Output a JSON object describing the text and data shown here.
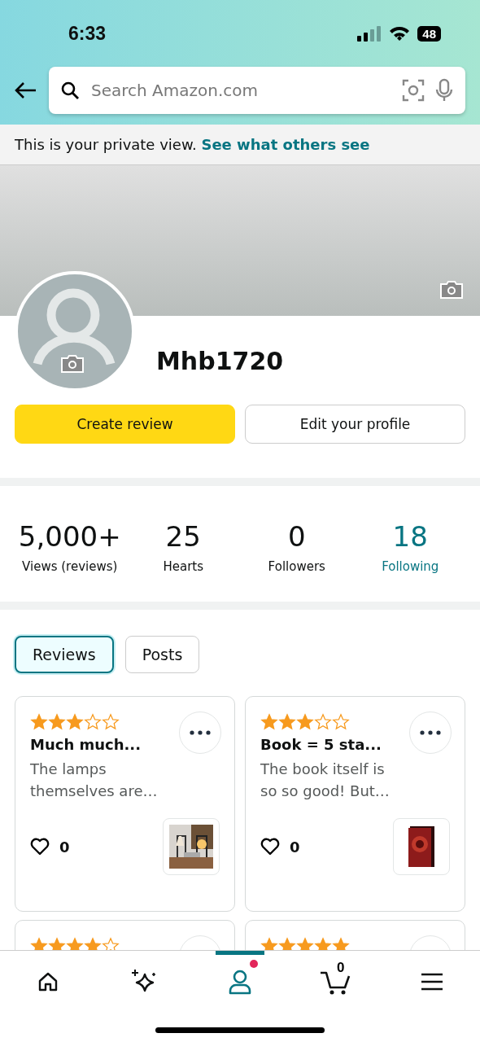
{
  "status_bar": {
    "time": "6:33",
    "battery": "48"
  },
  "search": {
    "placeholder": "Search Amazon.com"
  },
  "notice": {
    "text": "This is your private view.",
    "link": "See what others see"
  },
  "profile": {
    "name": "Mhb1720"
  },
  "actions": [
    {
      "label": "Create review",
      "kind": "primary"
    },
    {
      "label": "Edit your profile",
      "kind": "secondary"
    }
  ],
  "stats": [
    {
      "value": "5,000+",
      "label": "Views (reviews)",
      "kind": "count"
    },
    {
      "value": "25",
      "label": "Hearts",
      "kind": "count"
    },
    {
      "value": "0",
      "label": "Followers",
      "kind": "count"
    },
    {
      "value": "18",
      "label": "Following",
      "kind": "link"
    }
  ],
  "tabs": [
    {
      "label": "Reviews",
      "selected": true
    },
    {
      "label": "Posts",
      "selected": false
    }
  ],
  "reviews": [
    {
      "stars": 3,
      "title": "Much much...",
      "text": "The lamps themselves are…",
      "hearts": "0"
    },
    {
      "stars": 3,
      "title": "Book = 5 sta...",
      "text": "The book itself is so so good! But…",
      "hearts": "0"
    },
    {
      "stars": 4
    },
    {
      "stars": 5
    }
  ],
  "nav": [
    {
      "selected": false
    },
    {
      "selected": false
    },
    {
      "selected": true,
      "dot": true
    },
    {
      "selected": false,
      "count": "0"
    },
    {
      "selected": false
    }
  ]
}
